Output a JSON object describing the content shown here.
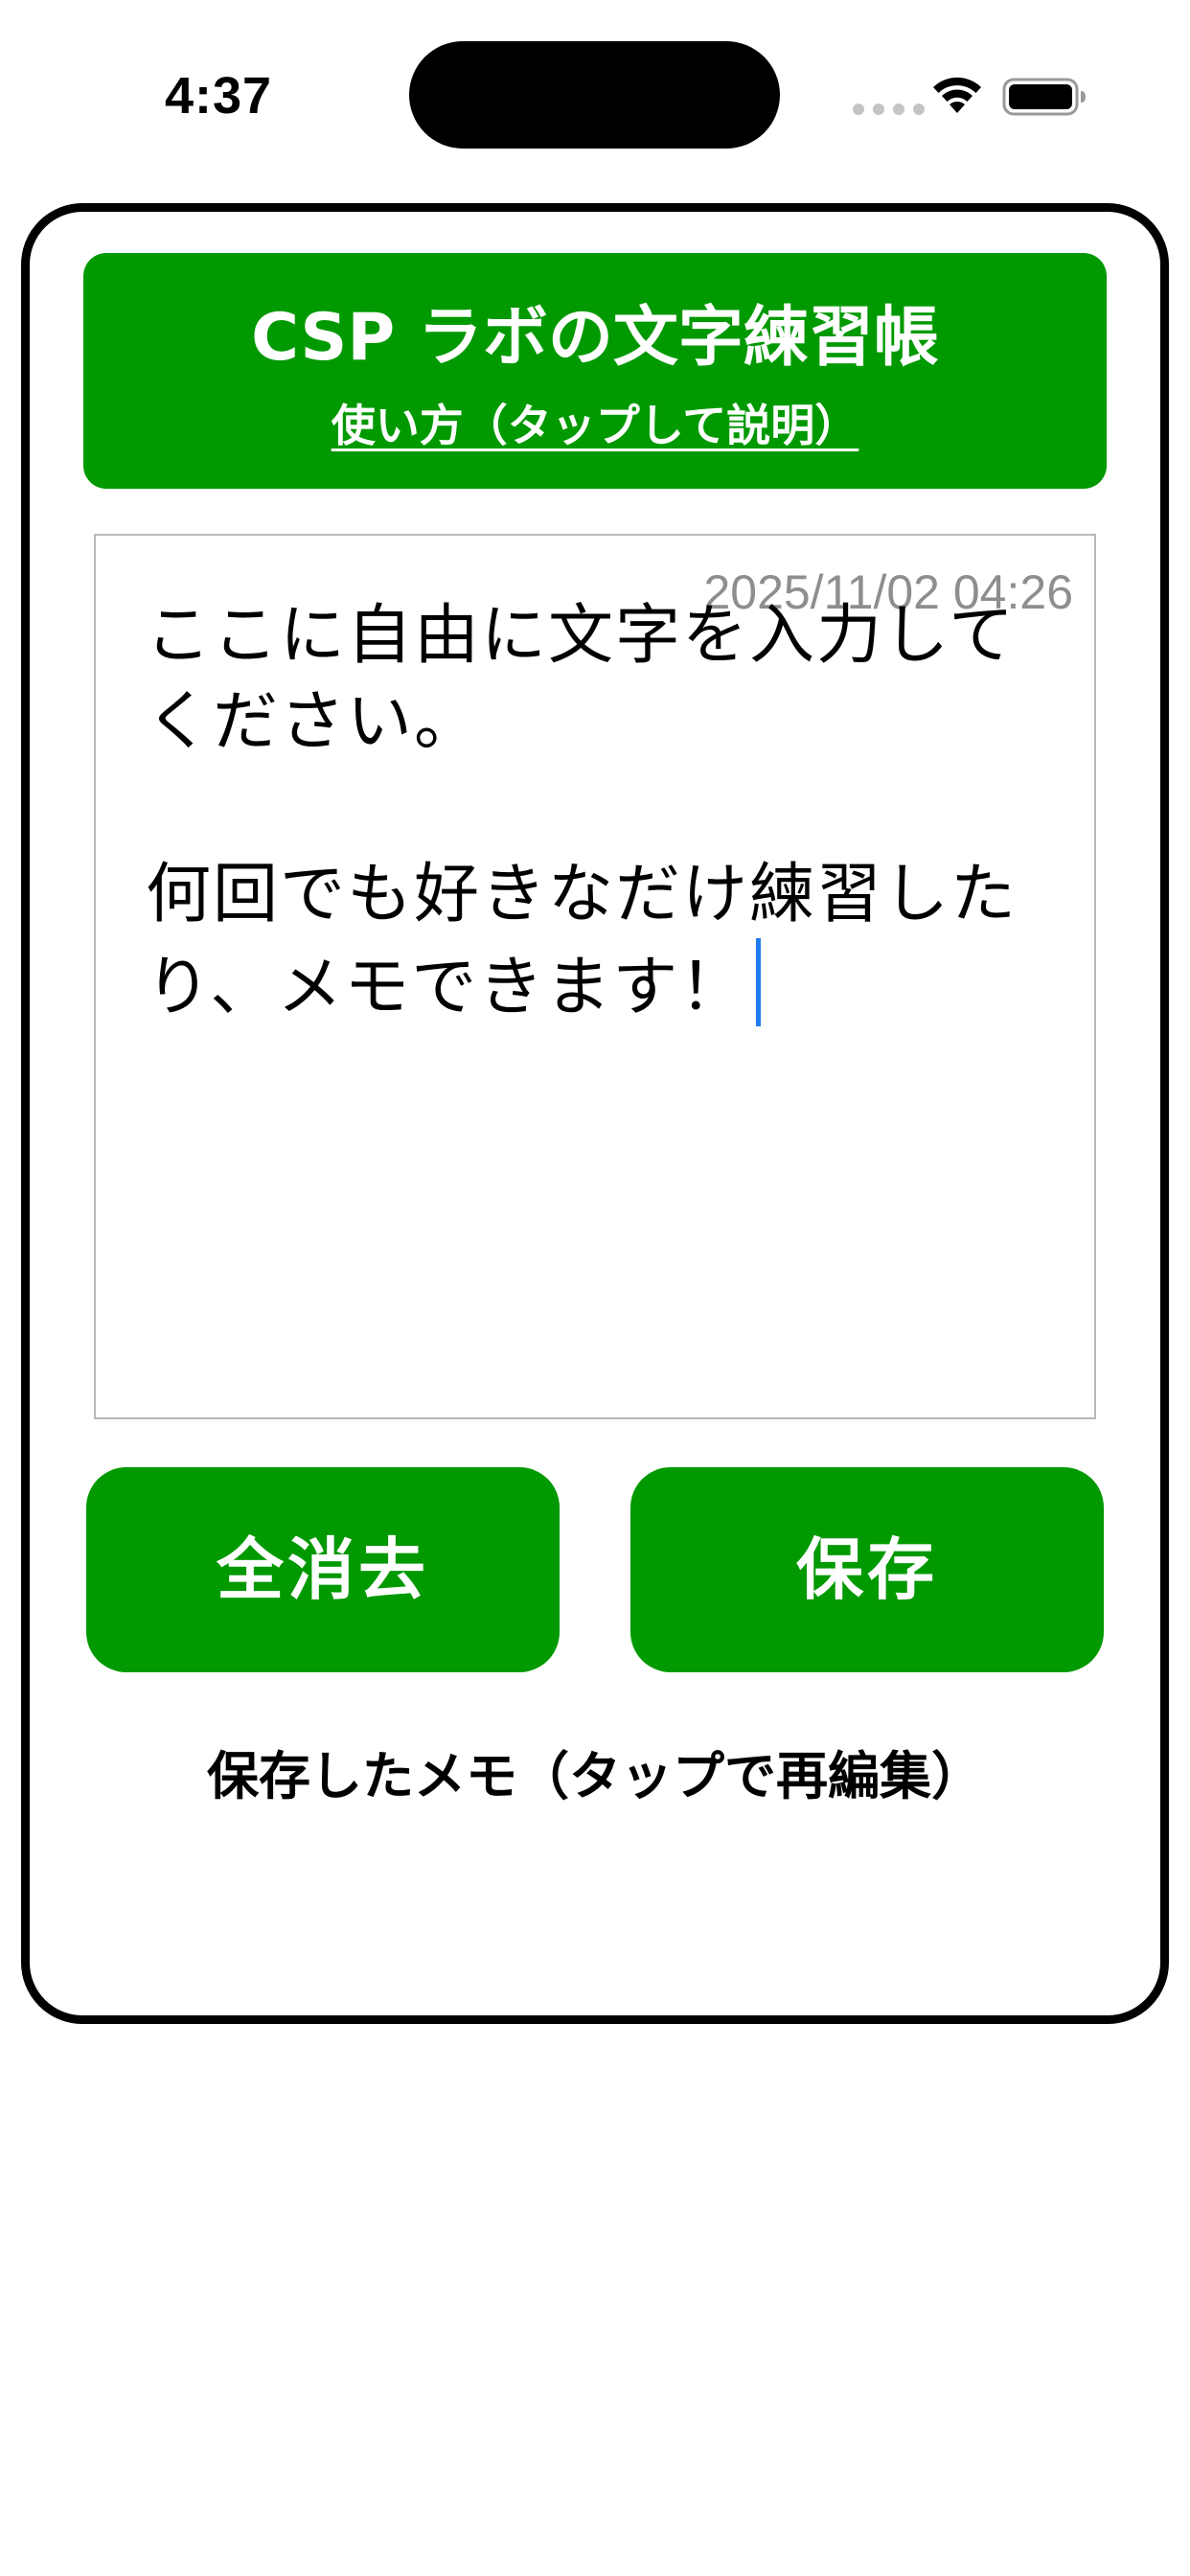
{
  "status_bar": {
    "time": "4:37",
    "icons": [
      "cellular-dots-icon",
      "wifi-icon",
      "battery-icon"
    ]
  },
  "header": {
    "title": "CSP ラボの文字練習帳",
    "help_link": "使い方（タップして説明）",
    "background_color": "#009900"
  },
  "editor": {
    "timestamp": "2025/11/02 04:26",
    "text": "ここに自由に文字を入力してください。\n\n何回でも好きなだけ練習したり、メモできます！",
    "caret_color": "#1f7cf2"
  },
  "buttons": {
    "clear_label": "全消去",
    "save_label": "保存"
  },
  "saved_section": {
    "heading": "保存したメモ（タップで再編集）"
  }
}
